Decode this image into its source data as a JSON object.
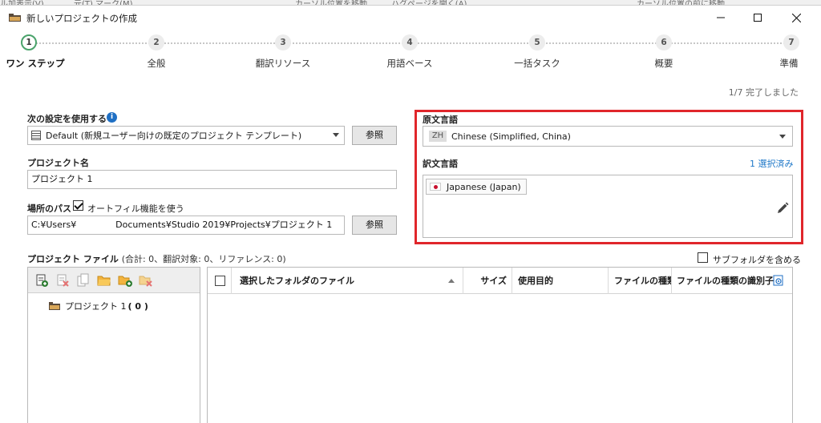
{
  "background_app": {
    "items": [
      "ル加表示(V)",
      "元(T) マーク(M)",
      "カーソル位置を移動",
      "ハグページを開く(A)",
      "カーソル位置の前に移動"
    ]
  },
  "window": {
    "title": "新しいプロジェクトの作成",
    "minimize": "—",
    "maximize": "☐",
    "close": "✕"
  },
  "steps": [
    {
      "number": "1",
      "label": "ワン ステップ",
      "active": true
    },
    {
      "number": "2",
      "label": "全般",
      "active": false
    },
    {
      "number": "3",
      "label": "翻訳リソース",
      "active": false
    },
    {
      "number": "4",
      "label": "用語ベース",
      "active": false
    },
    {
      "number": "5",
      "label": "一括タスク",
      "active": false
    },
    {
      "number": "6",
      "label": "概要",
      "active": false
    },
    {
      "number": "7",
      "label": "準備",
      "active": false
    }
  ],
  "progress": "1/7 完了しました",
  "settings": {
    "label": "次の設定を使用する",
    "info": "i",
    "template_value": "Default (新規ユーザー向けの既定のプロジェクト テンプレート)",
    "browse_label": "参照"
  },
  "project_name": {
    "label": "プロジェクト名",
    "value": "プロジェクト 1"
  },
  "location": {
    "label": "場所のパス",
    "autofill_label": "オートフィル機能を使う",
    "autofill_checked": true,
    "value": "C:¥Users¥              Documents¥Studio 2019¥Projects¥プロジェクト 1",
    "browse_label": "参照"
  },
  "source_language": {
    "label": "原文言語",
    "code": "ZH",
    "value": "Chinese (Simplified, China)"
  },
  "target_language": {
    "label": "訳文言語",
    "selected_count": "1 選択済み",
    "languages": [
      {
        "name": "Japanese (Japan)",
        "flag": "jp-flag-icon"
      }
    ]
  },
  "project_files": {
    "label": "プロジェクト ファイル",
    "stats": "(合計: 0、翻訳対象: 0、リファレンス: 0)",
    "subfolder_label": "サブフォルダを含める",
    "subfolder_checked": false,
    "tree": {
      "item_label": "プロジェクト 1",
      "item_count": "( 0 )"
    },
    "columns": [
      "選択したフォルダのファイル",
      "サイズ",
      "使用目的",
      "ファイルの種類",
      "ファイルの種類の識別子"
    ]
  },
  "colors": {
    "highlight_border": "#e0262b",
    "active_step": "#4aa36b",
    "link": "#1f78c8"
  }
}
